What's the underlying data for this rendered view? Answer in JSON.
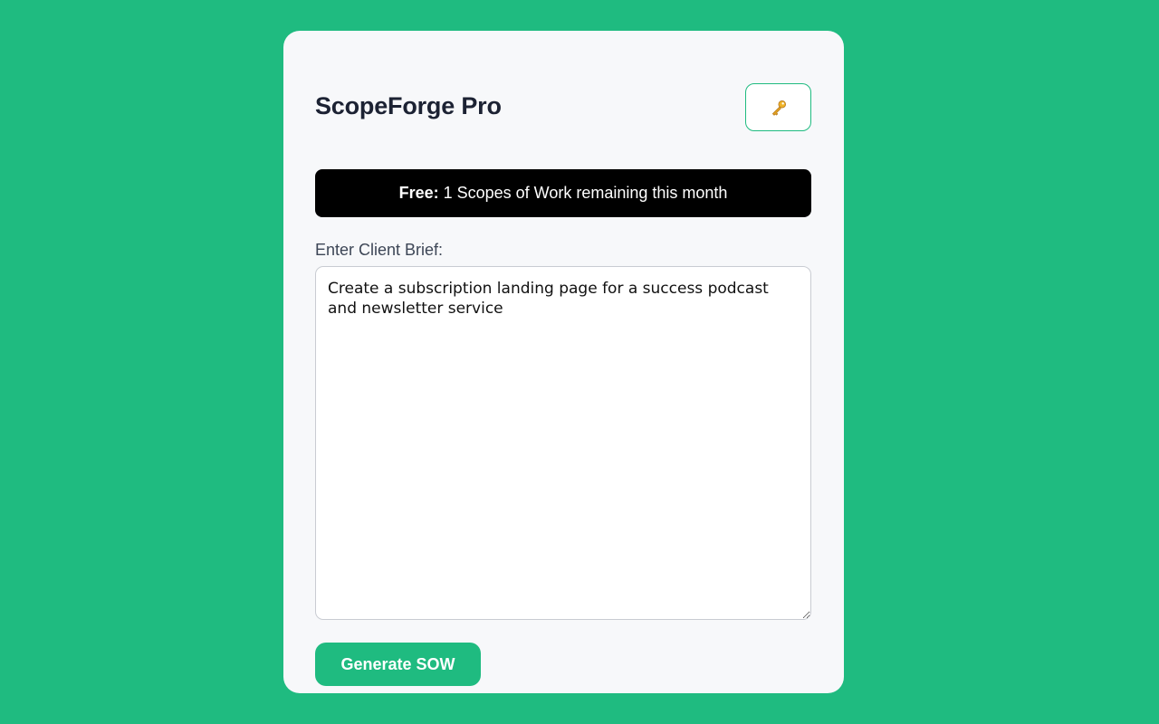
{
  "app": {
    "title": "ScopeForge Pro",
    "key_icon": "key-icon"
  },
  "plan_banner": {
    "plan_name": "Free:",
    "message": "1 Scopes of Work remaining this month"
  },
  "brief": {
    "label": "Enter Client Brief:",
    "value": "Create a subscription landing page for a success podcast and newsletter service"
  },
  "actions": {
    "generate_label": "Generate SOW"
  },
  "colors": {
    "background": "#1fbb80",
    "card": "#f7f8fa",
    "accent": "#1fbb80",
    "banner": "#000000",
    "title": "#1c2233"
  }
}
